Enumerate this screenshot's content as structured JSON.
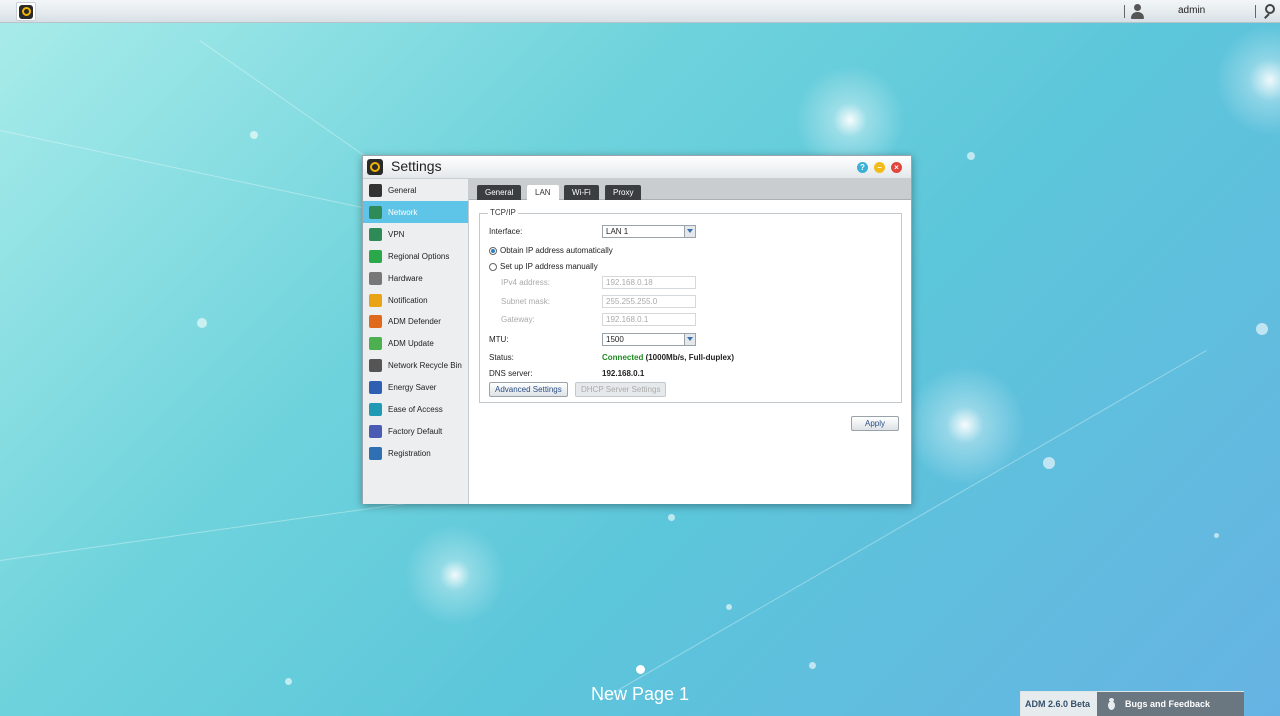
{
  "topbar": {
    "username": "admin"
  },
  "window": {
    "title": "Settings"
  },
  "sidebar": {
    "items": [
      {
        "label": "General",
        "icon": "general-icon",
        "color": "#333333"
      },
      {
        "label": "Network",
        "icon": "network-icon",
        "color": "#2e8b57",
        "active": true
      },
      {
        "label": "VPN",
        "icon": "vpn-icon",
        "color": "#2e8b57"
      },
      {
        "label": "Regional Options",
        "icon": "globe-icon",
        "color": "#2aa84a"
      },
      {
        "label": "Hardware",
        "icon": "hardware-icon",
        "color": "#777777"
      },
      {
        "label": "Notification",
        "icon": "notification-icon",
        "color": "#e8a317"
      },
      {
        "label": "ADM Defender",
        "icon": "firewall-icon",
        "color": "#e06a1b"
      },
      {
        "label": "ADM Update",
        "icon": "update-arrow-icon",
        "color": "#4caf50"
      },
      {
        "label": "Network Recycle Bin",
        "icon": "recycle-bin-icon",
        "color": "#555555"
      },
      {
        "label": "Energy Saver",
        "icon": "energy-icon",
        "color": "#2f5fb3"
      },
      {
        "label": "Ease of Access",
        "icon": "cloud-icon",
        "color": "#1e9ab5"
      },
      {
        "label": "Factory Default",
        "icon": "undo-icon",
        "color": "#4a5bb5"
      },
      {
        "label": "Registration",
        "icon": "registration-icon",
        "color": "#2f6fb3"
      }
    ]
  },
  "tabs": [
    "General",
    "LAN",
    "Wi-Fi",
    "Proxy"
  ],
  "active_tab": "LAN",
  "tcpip": {
    "legend": "TCP/IP",
    "interface_label": "Interface:",
    "interface_value": "LAN 1",
    "obtain_auto_label": "Obtain IP address automatically",
    "manual_label": "Set up IP address manually",
    "ipv4_label": "IPv4 address:",
    "ipv4_value": "192.168.0.18",
    "subnet_label": "Subnet mask:",
    "subnet_value": "255.255.255.0",
    "gateway_label": "Gateway:",
    "gateway_value": "192.168.0.1",
    "mtu_label": "MTU:",
    "mtu_value": "1500",
    "status_label": "Status:",
    "status_connected": "Connected",
    "status_detail": " (1000Mb/s, Full-duplex)",
    "dns_label": "DNS server:",
    "dns_value": "192.168.0.1",
    "advanced_button": "Advanced Settings",
    "dhcp_button": "DHCP Server Settings"
  },
  "apply_button": "Apply",
  "desktop": {
    "page_label": "New Page 1",
    "version": "ADM 2.6.0 Beta",
    "bugs_label": "Bugs and Feedback"
  },
  "colors": {
    "accent": "#5fc5e8",
    "status_green": "#1f8a1f",
    "tab_dark": "#3b3e41"
  }
}
